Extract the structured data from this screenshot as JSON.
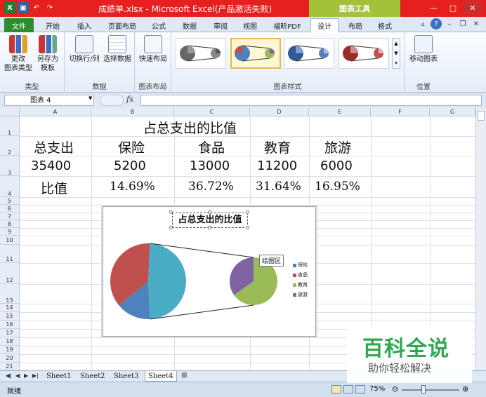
{
  "title_bar": {
    "doc_title": "成绩单.xlsx - Microsoft Excel(产品激活失败)",
    "context_tab": "图表工具",
    "app_icon": "excel-icon"
  },
  "tabs": [
    "文件",
    "开始",
    "插入",
    "页面布局",
    "公式",
    "数据",
    "审阅",
    "视图",
    "福昕PDF",
    "设计",
    "布局",
    "格式"
  ],
  "active_tab": "设计",
  "ribbon": {
    "groups": [
      {
        "label": "类型",
        "buttons": [
          "更改\n图表类型",
          "另存为\n模板"
        ]
      },
      {
        "label": "数据",
        "buttons": [
          "切换行/列",
          "选择数据"
        ]
      },
      {
        "label": "图表布局",
        "buttons": [
          "快速布局"
        ]
      },
      {
        "label": "图表样式",
        "buttons": []
      },
      {
        "label": "位置",
        "buttons": [
          "移动图表"
        ]
      }
    ]
  },
  "formula_bar": {
    "name_box": "图表 4",
    "fx": "fx",
    "formula": ""
  },
  "columns": [
    "A",
    "B",
    "C",
    "D",
    "E",
    "F",
    "G"
  ],
  "rows": [
    "1",
    "2",
    "3",
    "4",
    "5",
    "6",
    "7",
    "8",
    "9",
    "10",
    "11",
    "12",
    "13",
    "14",
    "15",
    "16",
    "17",
    "18",
    "19",
    "20",
    "21"
  ],
  "sheet": {
    "title": "占总支出的比值",
    "header": [
      "总支出",
      "保险",
      "食品",
      "教育",
      "旅游"
    ],
    "totals": [
      "35400",
      "5200",
      "13000",
      "11200",
      "6000"
    ],
    "ratio_label": "比值",
    "ratios": [
      "14.69%",
      "36.72%",
      "31.64%",
      "16.95%"
    ]
  },
  "chart": {
    "title": "占总支出的比值",
    "tooltip": "绘图区",
    "legend": [
      "保险",
      "食品",
      "教育",
      "旅游"
    ]
  },
  "chart_data": {
    "type": "pie",
    "title": "占总支出的比值",
    "categories": [
      "保险",
      "食品",
      "教育",
      "旅游"
    ],
    "values": [
      14.69,
      36.72,
      31.64,
      16.95
    ],
    "colors": [
      "#4f81bd",
      "#c0504d",
      "#9bbb59",
      "#8064a2"
    ]
  },
  "sheet_tabs": [
    "Sheet1",
    "Sheet2",
    "Sheet3",
    "Sheet4"
  ],
  "active_sheet": "Sheet4",
  "status": {
    "ready": "就绪",
    "zoom": "75%"
  },
  "watermark": {
    "title": "百科全说",
    "subtitle": "助你轻松解决"
  }
}
